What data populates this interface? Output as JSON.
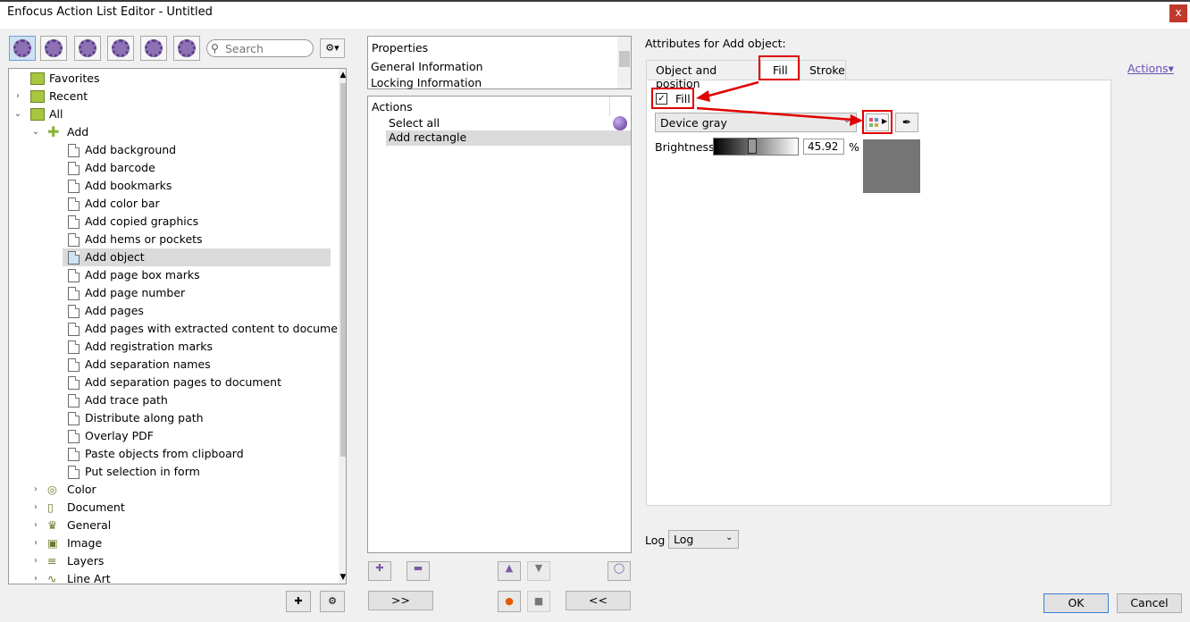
{
  "window": {
    "title": "Enfocus Action List Editor - Untitled",
    "close": "x"
  },
  "toolbar": {
    "search_placeholder": "Search",
    "settings_label": "⚙▾"
  },
  "tree": {
    "top": [
      {
        "label": "Favorites"
      },
      {
        "label": "Recent"
      },
      {
        "label": "All"
      }
    ],
    "add_label": "Add",
    "add_items": [
      "Add background",
      "Add barcode",
      "Add bookmarks",
      "Add color bar",
      "Add copied graphics",
      "Add hems or pockets",
      "Add object",
      "Add page box marks",
      "Add page number",
      "Add pages",
      "Add pages with extracted content to document",
      "Add registration marks",
      "Add separation names",
      "Add separation pages to document",
      "Add trace path",
      "Distribute along path",
      "Overlay PDF",
      "Paste objects from clipboard",
      "Put selection in form"
    ],
    "selected": "Add object",
    "categories": [
      "Color",
      "Document",
      "General",
      "Image",
      "Layers",
      "Line Art"
    ]
  },
  "properties": {
    "header": "Properties",
    "items": [
      "General Information",
      "Locking Information"
    ]
  },
  "actions": {
    "header": "Actions",
    "items": [
      "Select all",
      "Add rectangle"
    ]
  },
  "middle_buttons": {
    "forward": ">>",
    "back": "<<"
  },
  "attributes": {
    "title": "Attributes for Add object:",
    "actions_link": "Actions▾",
    "tabs": [
      "Object and position",
      "Fill",
      "Stroke"
    ],
    "fill_checkbox_label": "Fill",
    "colorspace": "Device gray",
    "brightness_label": "Brightness",
    "brightness_value": "45.92",
    "brightness_unit": "%",
    "swatch_color": "#757575"
  },
  "log": {
    "label": "Log",
    "value": "Log"
  },
  "dialog_buttons": {
    "ok": "OK",
    "cancel": "Cancel"
  }
}
